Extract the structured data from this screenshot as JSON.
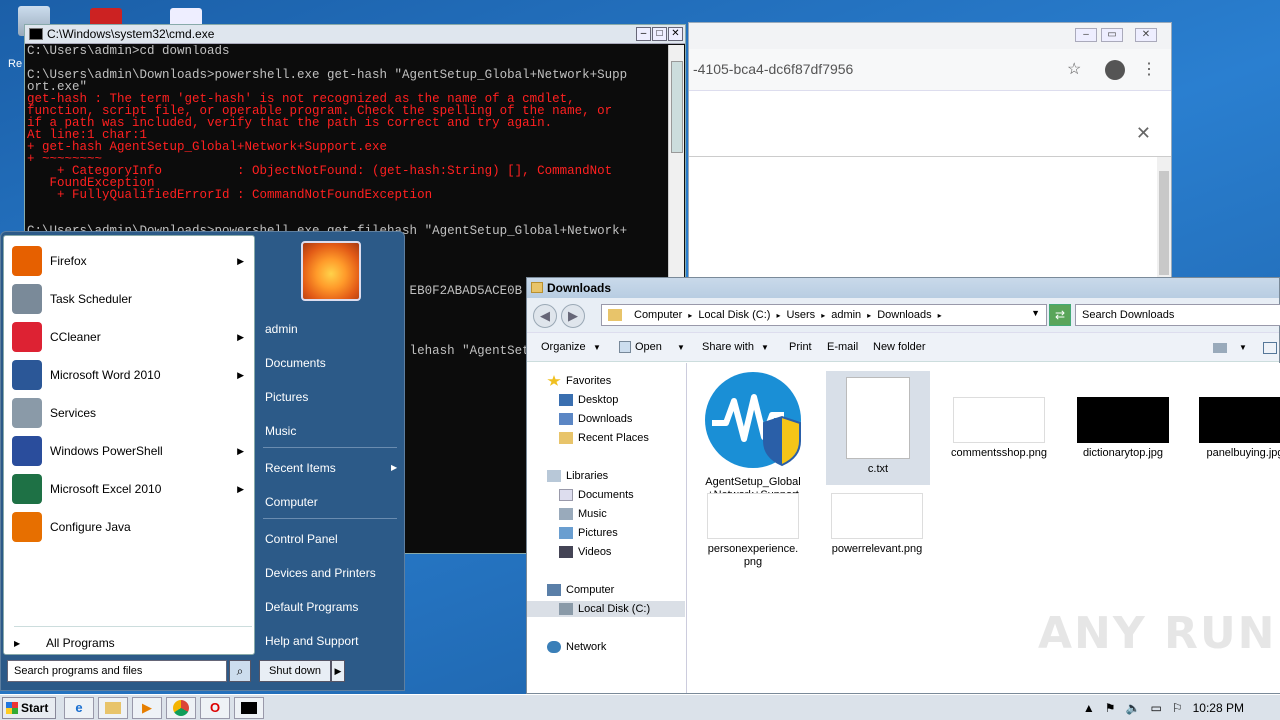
{
  "desktop": {
    "recycle_label": "Re"
  },
  "cmd": {
    "title": "C:\\Windows\\system32\\cmd.exe",
    "lines": [
      {
        "t": "C:\\Users\\admin>cd downloads",
        "c": "white"
      },
      {
        "t": "",
        "c": "white"
      },
      {
        "t": "C:\\Users\\admin\\Downloads>powershell.exe get-hash \"AgentSetup_Global+Network+Supp",
        "c": "white"
      },
      {
        "t": "ort.exe\"",
        "c": "white"
      },
      {
        "t": "get-hash : The term 'get-hash' is not recognized as the name of a cmdlet,",
        "c": "red"
      },
      {
        "t": "function, script file, or operable program. Check the spelling of the name, or",
        "c": "red"
      },
      {
        "t": "if a path was included, verify that the path is correct and try again.",
        "c": "red"
      },
      {
        "t": "At line:1 char:1",
        "c": "red"
      },
      {
        "t": "+ get-hash AgentSetup_Global+Network+Support.exe",
        "c": "red"
      },
      {
        "t": "+ ~~~~~~~~",
        "c": "red"
      },
      {
        "t": "    + CategoryInfo          : ObjectNotFound: (get-hash:String) [], CommandNot",
        "c": "red"
      },
      {
        "t": "   FoundException",
        "c": "red"
      },
      {
        "t": "    + FullyQualifiedErrorId : CommandNotFoundException",
        "c": "red"
      },
      {
        "t": "",
        "c": "white"
      },
      {
        "t": "",
        "c": "white"
      },
      {
        "t": "C:\\Users\\admin\\Downloads>powershell.exe get-filehash \"AgentSetup_Global+Network+",
        "c": "white"
      },
      {
        "t": "",
        "c": "white"
      },
      {
        "t": "",
        "c": "white"
      },
      {
        "t": "",
        "c": "white"
      },
      {
        "t": "",
        "c": "white"
      },
      {
        "t": "                                                   EB0F2ABAD5ACE0B",
        "c": "white"
      },
      {
        "t": "",
        "c": "white"
      },
      {
        "t": "",
        "c": "white"
      },
      {
        "t": "",
        "c": "white"
      },
      {
        "t": "",
        "c": "white"
      },
      {
        "t": "                                                   lehash \"AgentSet",
        "c": "white"
      }
    ]
  },
  "chrome": {
    "url_fragment": "-4105-bca4-dc6f87df7956",
    "star_icon": "star-icon",
    "close_glyph": "✕"
  },
  "explorer": {
    "title": "Downloads",
    "breadcrumbs": [
      "Computer",
      "Local Disk (C:)",
      "Users",
      "admin",
      "Downloads"
    ],
    "search_placeholder": "Search Downloads",
    "toolbar": [
      "Organize",
      "Open",
      "Share with",
      "Print",
      "E-mail",
      "New folder"
    ],
    "nav": {
      "favorites": "Favorites",
      "desktop": "Desktop",
      "downloads": "Downloads",
      "recent": "Recent Places",
      "libraries": "Libraries",
      "documents": "Documents",
      "music": "Music",
      "pictures": "Pictures",
      "videos": "Videos",
      "computer": "Computer",
      "localdisk": "Local Disk (C:)",
      "network": "Network"
    },
    "files": [
      {
        "name": "AgentSetup_Global +Network+Support .exe"
      },
      {
        "name": "c.txt"
      },
      {
        "name": "commentsshop.png"
      },
      {
        "name": "dictionarytop.jpg"
      },
      {
        "name": "panelbuying.jpg"
      },
      {
        "name": "personexperience. png"
      },
      {
        "name": "powerrelevant.png"
      }
    ]
  },
  "startmenu": {
    "programs": [
      {
        "label": "Firefox",
        "arrow": true,
        "color": "#e66000"
      },
      {
        "label": "Task Scheduler",
        "arrow": false,
        "color": "#7a8a99"
      },
      {
        "label": "CCleaner",
        "arrow": true,
        "color": "#d23"
      },
      {
        "label": "Microsoft Word 2010",
        "arrow": true,
        "color": "#2b5797"
      },
      {
        "label": "Services",
        "arrow": false,
        "color": "#8a9aa8"
      },
      {
        "label": "Windows PowerShell",
        "arrow": true,
        "color": "#2a4d9c"
      },
      {
        "label": "Microsoft Excel 2010",
        "arrow": true,
        "color": "#1e7145"
      },
      {
        "label": "Configure Java",
        "arrow": false,
        "color": "#e76f00"
      }
    ],
    "all_programs": "All Programs",
    "search_placeholder": "Search programs and files",
    "right": {
      "admin": "admin",
      "documents": "Documents",
      "pictures": "Pictures",
      "music": "Music",
      "recent_items": "Recent Items",
      "computer": "Computer",
      "control_panel": "Control Panel",
      "devices": "Devices and Printers",
      "default_programs": "Default Programs",
      "help": "Help and Support"
    },
    "shutdown": "Shut down"
  },
  "taskbar": {
    "start": "Start",
    "clock": "10:28 PM"
  },
  "watermark": "ANY RUN"
}
